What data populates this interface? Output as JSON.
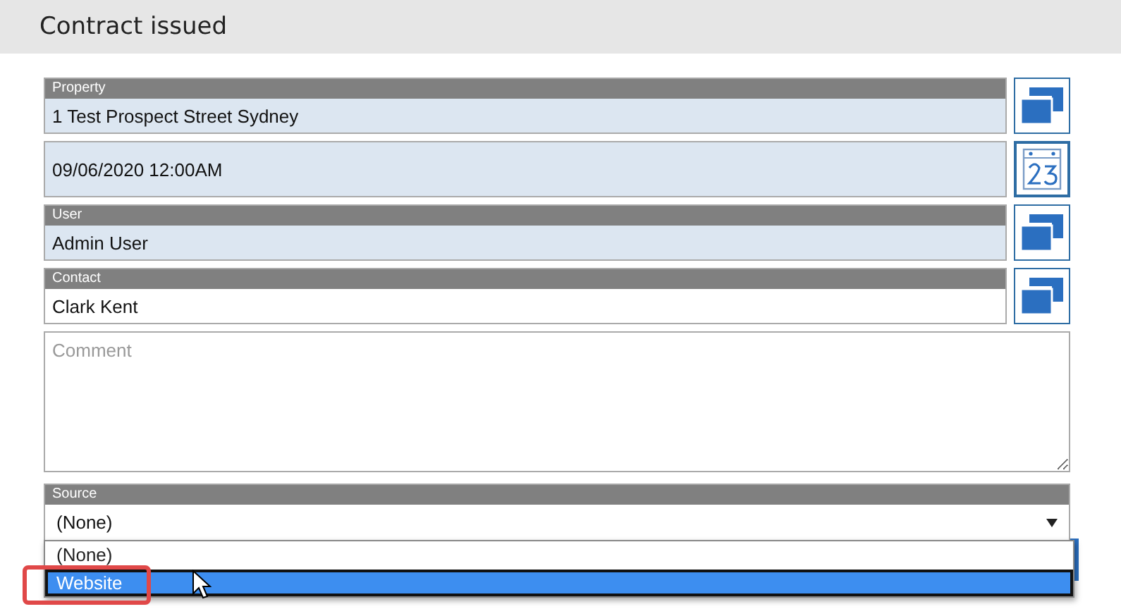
{
  "header": {
    "title": "Contract issued"
  },
  "fields": [
    {
      "kind": "lookup",
      "label": "Property",
      "value": "1 Test Prospect Street Sydney",
      "readonly": true
    },
    {
      "kind": "date",
      "value": "09/06/2020 12:00AM",
      "readonly": true
    },
    {
      "kind": "lookup",
      "label": "User",
      "value": "Admin User",
      "readonly": true
    },
    {
      "kind": "lookup",
      "label": "Contact",
      "value": "Clark Kent",
      "readonly": false
    }
  ],
  "comment": {
    "placeholder": "Comment"
  },
  "source": {
    "label": "Source",
    "value": "(None)",
    "open": true,
    "options": [
      {
        "label": "(None)",
        "highlighted": false
      },
      {
        "label": "Website",
        "highlighted": true
      }
    ]
  }
}
